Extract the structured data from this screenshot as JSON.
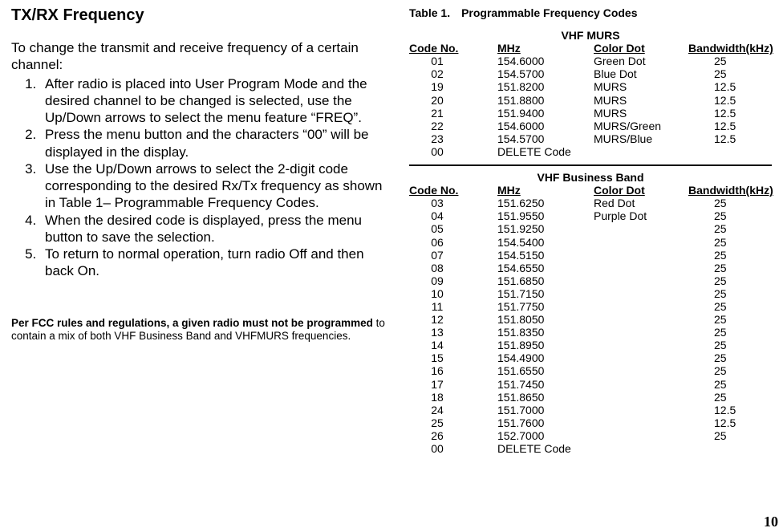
{
  "page_number": "10",
  "title": "TX/RX Frequency",
  "intro": "To change the transmit and receive frequency of a certain channel:",
  "steps": [
    "After radio is placed into User Program Mode and the desired channel to be changed is selected, use the Up/Down arrows to select the menu feature “FREQ”.",
    "Press the menu button and the characters “00” will be displayed in the display.",
    "Use the Up/Down arrows to select the 2-digit code corresponding to the desired Rx/Tx frequency as shown in Table 1– Programmable Frequency Codes.",
    "When the desired code is displayed, press the menu button to save the selection.",
    "To return to normal operation, turn radio Off and then back On."
  ],
  "fcc": {
    "lead": "Per FCC rules and regulations, a given radio must not be programmed",
    "rest": " to contain a mix of both VHF Business Band and VHFMURS frequencies."
  },
  "table": {
    "caption": "Table 1. Programmable Frequency Codes",
    "headers": {
      "code": "Code No.",
      "mhz": "MHz",
      "dot": "Color Dot",
      "bw": "Bandwidth(kHz)"
    },
    "section1_title": "VHF MURS",
    "section1_rows": [
      {
        "code": "01",
        "mhz": "154.6000",
        "dot": "Green Dot",
        "bw": "25"
      },
      {
        "code": "02",
        "mhz": "154.5700",
        "dot": "Blue Dot",
        "bw": "25"
      },
      {
        "code": "19",
        "mhz": "151.8200",
        "dot": "MURS",
        "bw": "12.5"
      },
      {
        "code": "20",
        "mhz": "151.8800",
        "dot": "MURS",
        "bw": "12.5"
      },
      {
        "code": "21",
        "mhz": "151.9400",
        "dot": "MURS",
        "bw": "12.5"
      },
      {
        "code": "22",
        "mhz": "154.6000",
        "dot": "MURS/Green",
        "bw": "12.5"
      },
      {
        "code": "23",
        "mhz": "154.5700",
        "dot": "MURS/Blue",
        "bw": "12.5"
      },
      {
        "code": "00",
        "mhz": "DELETE Code",
        "dot": "",
        "bw": ""
      }
    ],
    "section2_title": "VHF Business Band",
    "section2_rows": [
      {
        "code": "03",
        "mhz": "151.6250",
        "dot": "Red Dot",
        "bw": "25"
      },
      {
        "code": "04",
        "mhz": "151.9550",
        "dot": "Purple Dot",
        "bw": "25"
      },
      {
        "code": "05",
        "mhz": "151.9250",
        "dot": "",
        "bw": "25"
      },
      {
        "code": "06",
        "mhz": "154.5400",
        "dot": "",
        "bw": "25"
      },
      {
        "code": "07",
        "mhz": "154.5150",
        "dot": "",
        "bw": "25"
      },
      {
        "code": "08",
        "mhz": "154.6550",
        "dot": "",
        "bw": "25"
      },
      {
        "code": "09",
        "mhz": "151.6850",
        "dot": "",
        "bw": "25"
      },
      {
        "code": "10",
        "mhz": "151.7150",
        "dot": "",
        "bw": "25"
      },
      {
        "code": "11",
        "mhz": "151.7750",
        "dot": "",
        "bw": "25"
      },
      {
        "code": "12",
        "mhz": "151.8050",
        "dot": "",
        "bw": "25"
      },
      {
        "code": "13",
        "mhz": "151.8350",
        "dot": "",
        "bw": "25"
      },
      {
        "code": "14",
        "mhz": "151.8950",
        "dot": "",
        "bw": "25"
      },
      {
        "code": "15",
        "mhz": "154.4900",
        "dot": "",
        "bw": "25"
      },
      {
        "code": "16",
        "mhz": "151.6550",
        "dot": "",
        "bw": "25"
      },
      {
        "code": "17",
        "mhz": "151.7450",
        "dot": "",
        "bw": "25"
      },
      {
        "code": "18",
        "mhz": "151.8650",
        "dot": "",
        "bw": "25"
      },
      {
        "code": "24",
        "mhz": "151.7000",
        "dot": "",
        "bw": "12.5"
      },
      {
        "code": "25",
        "mhz": "151.7600",
        "dot": "",
        "bw": "12.5"
      },
      {
        "code": "26",
        "mhz": "152.7000",
        "dot": "",
        "bw": "25"
      },
      {
        "code": "00",
        "mhz": "DELETE Code",
        "dot": "",
        "bw": ""
      }
    ]
  }
}
